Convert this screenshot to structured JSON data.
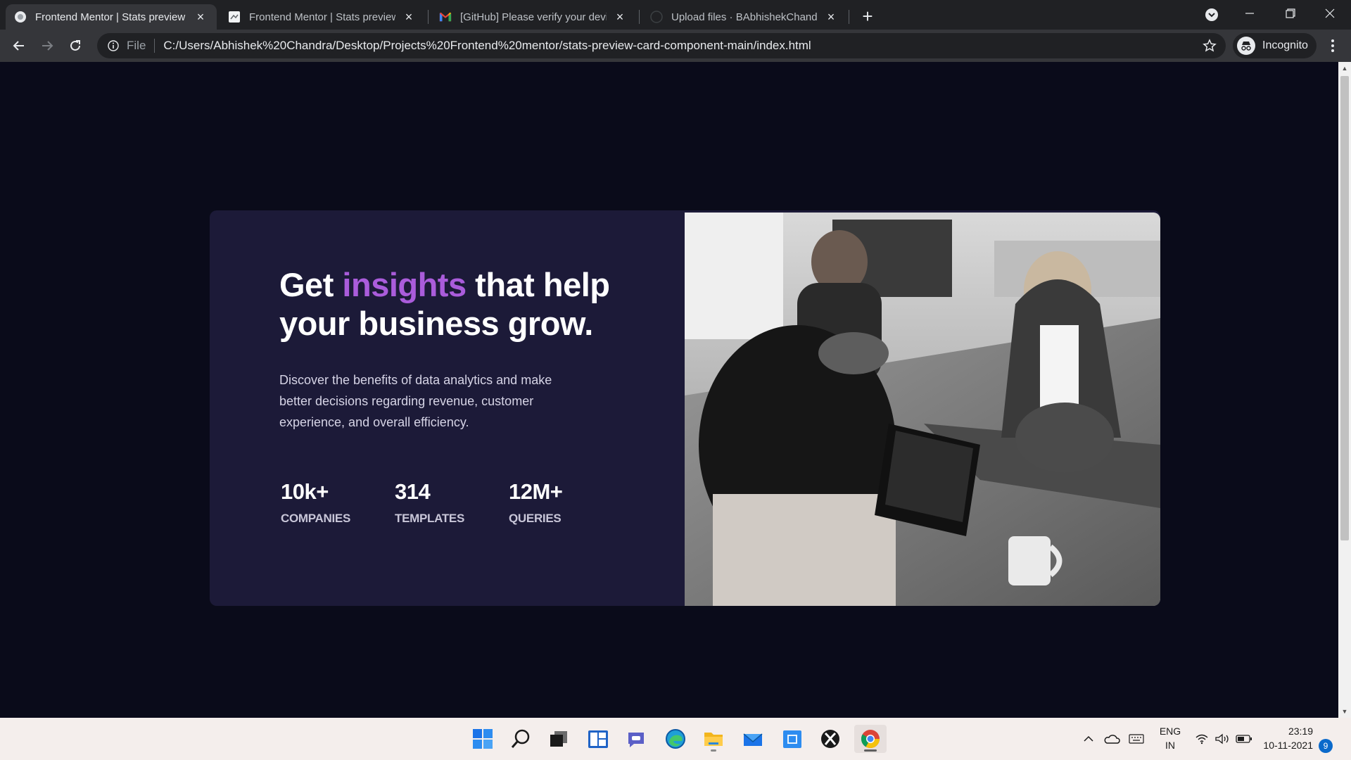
{
  "browser": {
    "tabs": [
      {
        "title": "Frontend Mentor | Stats preview card component",
        "favicon": "globe-icon",
        "active": true
      },
      {
        "title": "Frontend Mentor | Stats preview card component",
        "favicon": "page-icon",
        "active": false
      },
      {
        "title": "[GitHub] Please verify your device",
        "favicon": "gmail-icon",
        "active": false
      },
      {
        "title": "Upload files · BAbhishekChandra/stats-preview",
        "favicon": "github-icon",
        "active": false
      }
    ],
    "address": {
      "scheme_label": "File",
      "url": "C:/Users/Abhishek%20Chandra/Desktop/Projects%20Frontend%20mentor/stats-preview-card-component-main/index.html"
    },
    "profile_label": "Incognito"
  },
  "card": {
    "headline": {
      "before": "Get ",
      "accent": "insights",
      "after": " that help your business grow."
    },
    "description": "Discover the benefits of data analytics and make better decisions regarding revenue, customer experience, and overall efficiency.",
    "stats": [
      {
        "value": "10k+",
        "label": "COMPANIES"
      },
      {
        "value": "314",
        "label": "TEMPLATES"
      },
      {
        "value": "12M+",
        "label": "QUERIES"
      }
    ],
    "colors": {
      "background": "#1c1a38",
      "accent": "#aa5cdb",
      "page": "#0a0b1a"
    }
  },
  "taskbar": {
    "apps": [
      "windows-start-icon",
      "search-icon",
      "task-view-icon",
      "widgets-icon",
      "teams-chat-icon",
      "edge-icon",
      "file-explorer-icon",
      "mail-icon",
      "store-icon",
      "xbox-icon",
      "chrome-icon"
    ],
    "language": {
      "line1": "ENG",
      "line2": "IN"
    },
    "time": "23:19",
    "date": "10-11-2021",
    "notification_count": "9"
  }
}
